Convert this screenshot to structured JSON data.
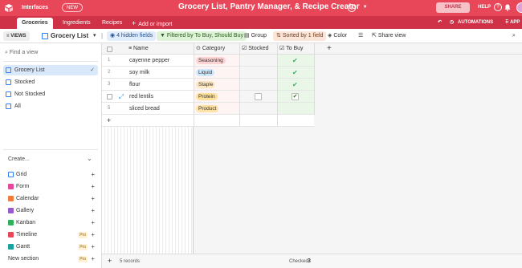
{
  "header": {
    "interfaces_label": "Interfaces",
    "new_badge": "NEW",
    "base_title": "Grocery List, Pantry Manager, & Recipe Creator",
    "share_label": "SHARE",
    "help_label": "HELP",
    "accent_color": "#e8475a"
  },
  "tabs": {
    "items": [
      "Groceries",
      "Ingredients",
      "Recipes"
    ],
    "add_import": "Add or import",
    "automations": "AUTOMATIONS",
    "apps": "APP"
  },
  "toolbar": {
    "views_label": "VIEWS",
    "view_name": "Grocery List",
    "hidden_fields": "4 hidden fields",
    "filter": "Filtered by To Buy, Should Buy",
    "group": "Group",
    "sort": "Sorted by 1 field",
    "color": "Color",
    "share_view": "Share view"
  },
  "sidebar": {
    "find_placeholder": "Find a view",
    "views": [
      "Grocery List",
      "Stocked",
      "Not Stocked",
      "All"
    ],
    "create_label": "Create...",
    "create_items": [
      {
        "label": "Grid",
        "pro": ""
      },
      {
        "label": "Form",
        "pro": ""
      },
      {
        "label": "Calendar",
        "pro": ""
      },
      {
        "label": "Gallery",
        "pro": ""
      },
      {
        "label": "Kanban",
        "pro": ""
      },
      {
        "label": "Timeline",
        "pro": "Pro"
      },
      {
        "label": "Gantt",
        "pro": "Pro"
      },
      {
        "label": "New section",
        "pro": "Pro"
      }
    ]
  },
  "grid": {
    "columns": [
      "Name",
      "Category",
      "Stocked",
      "To Buy"
    ],
    "rows": [
      {
        "num": "1",
        "name": "cayenne pepper",
        "category": "Seasoning",
        "to_buy": true
      },
      {
        "num": "2",
        "name": "soy milk",
        "category": "Liquid",
        "to_buy": true
      },
      {
        "num": "3",
        "name": "flour",
        "category": "Staple",
        "to_buy": true
      },
      {
        "num": "",
        "name": "red lentils",
        "category": "Protein",
        "to_buy": true
      },
      {
        "num": "5",
        "name": "sliced bread",
        "category": "Product",
        "to_buy": false
      }
    ],
    "chip_colors": {
      "Seasoning": "#ffd3d3",
      "Liquid": "#cfe8fc",
      "Staple": "#ffe8c2",
      "Protein": "#ffe29a",
      "Product": "#ffe3a6"
    },
    "records_count": "5 records",
    "checked_label": "Checked",
    "checked_count": "3"
  }
}
